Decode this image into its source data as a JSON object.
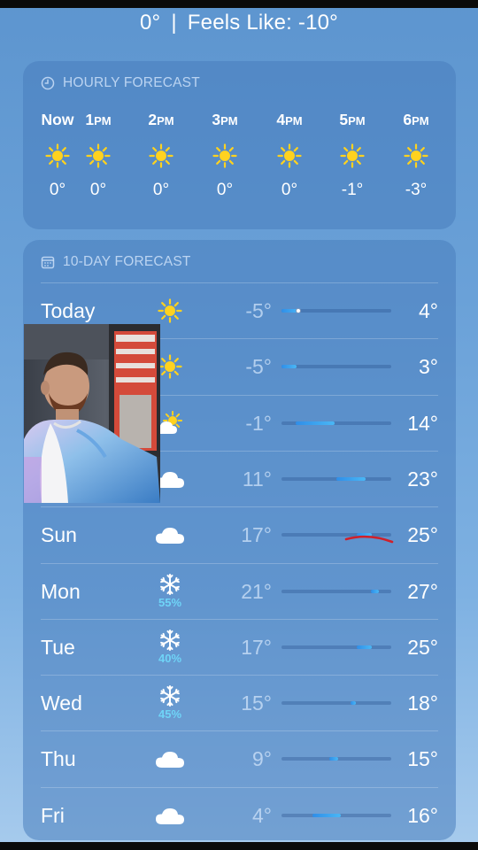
{
  "current": {
    "temp": "0°",
    "separator": "|",
    "feels_like": "Feels Like: -10°"
  },
  "hourly": {
    "header": "HOURLY FORECAST",
    "items": [
      {
        "time": "Now",
        "icon": "sun-icon",
        "temp": "0°"
      },
      {
        "time": "1PM",
        "icon": "sun-icon",
        "temp": "0°"
      },
      {
        "time": "2PM",
        "icon": "sun-icon",
        "temp": "0°"
      },
      {
        "time": "3PM",
        "icon": "sun-icon",
        "temp": "0°"
      },
      {
        "time": "4PM",
        "icon": "sun-icon",
        "temp": "0°"
      },
      {
        "time": "5PM",
        "icon": "sun-icon",
        "temp": "-1°"
      },
      {
        "time": "6PM",
        "icon": "sun-icon",
        "temp": "-3°"
      }
    ]
  },
  "daily": {
    "header": "10-DAY FORECAST",
    "days": [
      {
        "day": "Today",
        "icon": "sun-icon",
        "precip": "",
        "low": "-5°",
        "high": "4°"
      },
      {
        "day": "",
        "icon": "sun-icon",
        "precip": "",
        "low": "-5°",
        "high": "3°"
      },
      {
        "day": "",
        "icon": "partly-cloudy-icon",
        "precip": "",
        "low": "-1°",
        "high": "14°"
      },
      {
        "day": "",
        "icon": "cloud-icon",
        "precip": "",
        "low": "11°",
        "high": "23°"
      },
      {
        "day": "Sun",
        "icon": "cloud-icon",
        "precip": "",
        "low": "17°",
        "high": "25°"
      },
      {
        "day": "Mon",
        "icon": "snowflake-icon",
        "precip": "55%",
        "low": "21°",
        "high": "27°"
      },
      {
        "day": "Tue",
        "icon": "snowflake-icon",
        "precip": "40%",
        "low": "17°",
        "high": "25°"
      },
      {
        "day": "Wed",
        "icon": "snowflake-icon",
        "precip": "45%",
        "low": "15°",
        "high": "18°"
      },
      {
        "day": "Thu",
        "icon": "cloud-icon",
        "precip": "",
        "low": "9°",
        "high": "15°"
      },
      {
        "day": "Fri",
        "icon": "cloud-icon",
        "precip": "",
        "low": "4°",
        "high": "16°"
      }
    ],
    "scale": {
      "min": -5,
      "max": 27
    },
    "current_marker": 0
  },
  "colors": {
    "accent_bar": "#3ea6f2",
    "precip": "#6fd4f7",
    "annotation": "#d0202a",
    "sun": "#ffd21f"
  }
}
